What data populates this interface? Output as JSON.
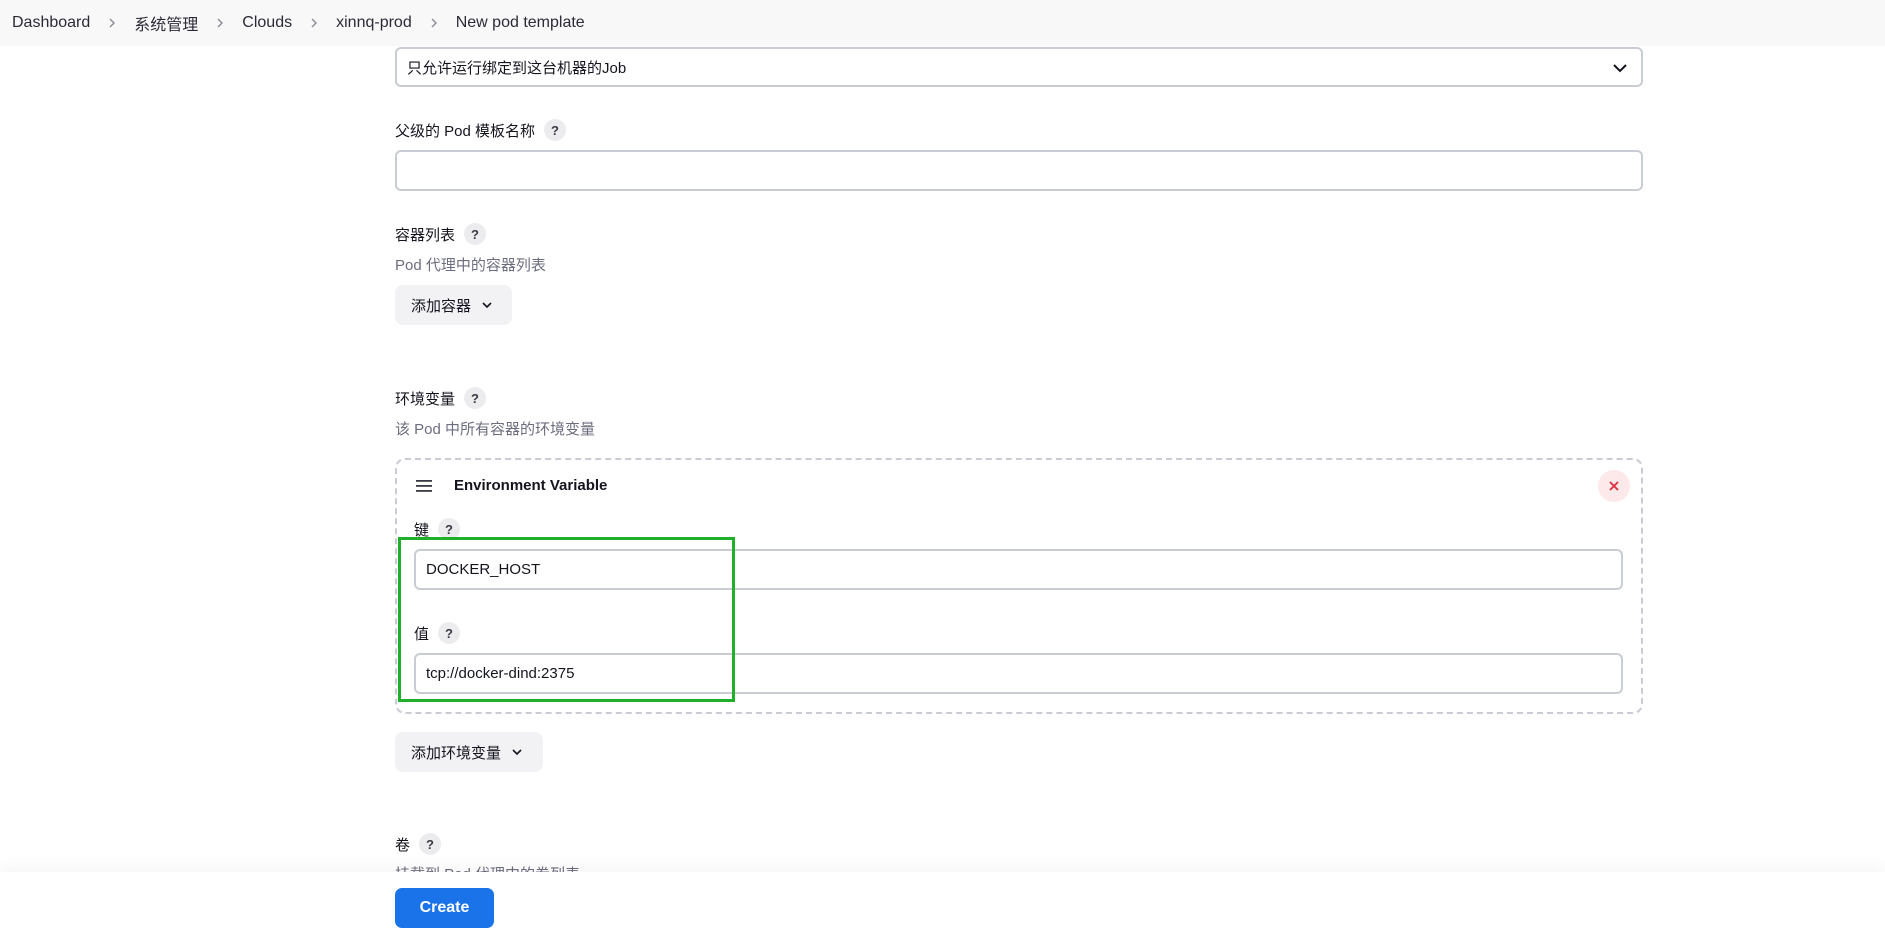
{
  "breadcrumb": [
    {
      "label": "Dashboard"
    },
    {
      "label": "系统管理"
    },
    {
      "label": "Clouds"
    },
    {
      "label": "xinnq-prod"
    },
    {
      "label": "New pod template"
    }
  ],
  "usage_select": {
    "value": "只允许运行绑定到这台机器的Job"
  },
  "parent_template": {
    "label": "父级的 Pod 模板名称",
    "help": "?",
    "value": ""
  },
  "containers": {
    "label": "容器列表",
    "help": "?",
    "description": "Pod 代理中的容器列表",
    "add_button": "添加容器"
  },
  "env_vars": {
    "label": "环境变量",
    "help": "?",
    "description": "该 Pod 中所有容器的环境变量",
    "item": {
      "title": "Environment Variable",
      "key_label": "键",
      "key_help": "?",
      "key_value": "DOCKER_HOST",
      "value_label": "值",
      "value_help": "?",
      "value_value": "tcp://docker-dind:2375"
    },
    "add_button": "添加环境变量"
  },
  "volumes": {
    "label": "卷",
    "help": "?",
    "description": "挂载到 Pod 代理中的卷列表"
  },
  "actions": {
    "create": "Create"
  },
  "colors": {
    "primary": "#1a73e8",
    "highlight": "#1faf2a",
    "delete_bg": "#fde8ea",
    "delete_icon": "#e02d3c"
  },
  "icons": {
    "chevron_right": "chevron-right-icon",
    "chevron_down": "chevron-down-icon",
    "drag": "drag-handle-icon",
    "close": "close-icon"
  }
}
